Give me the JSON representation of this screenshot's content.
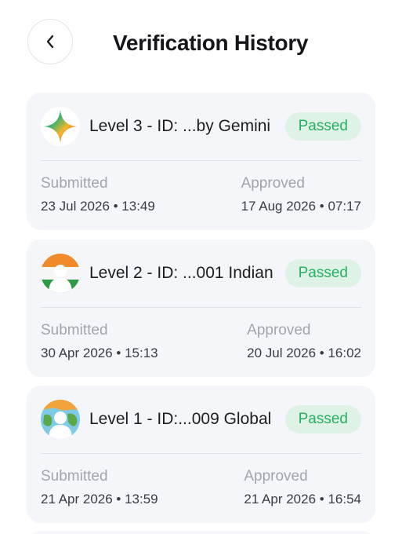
{
  "header": {
    "back_icon": "chevron-left-icon",
    "title": "Verification History"
  },
  "records": [
    {
      "level_label": "Level 3 - ID: ...by Gemini",
      "avatar_icon": "gemini-sparkle-icon",
      "status": "Passed",
      "submitted_label": "Submitted",
      "submitted_value": "23 Jul 2026 • 13:49",
      "approved_label": "Approved",
      "approved_value": "17 Aug 2026 • 07:17"
    },
    {
      "level_label": "Level 2 - ID: ...001 Indian",
      "avatar_icon": "india-flag-avatar-icon",
      "status": "Passed",
      "submitted_label": "Submitted",
      "submitted_value": "30 Apr 2026 • 15:13",
      "approved_label": "Approved",
      "approved_value": "20 Jul 2026 • 16:02"
    },
    {
      "level_label": "Level 1 - ID:...009 Global",
      "avatar_icon": "globe-avatar-icon",
      "status": "Passed",
      "submitted_label": "Submitted",
      "submitted_value": "21 Apr 2026 • 13:59",
      "approved_label": "Approved",
      "approved_value": "21 Apr 2026 • 16:54"
    }
  ],
  "colors": {
    "card_bg": "#f5f6f9",
    "badge_bg": "#dff2e6",
    "badge_text": "#27b062",
    "muted_text": "#a3a5ad"
  }
}
